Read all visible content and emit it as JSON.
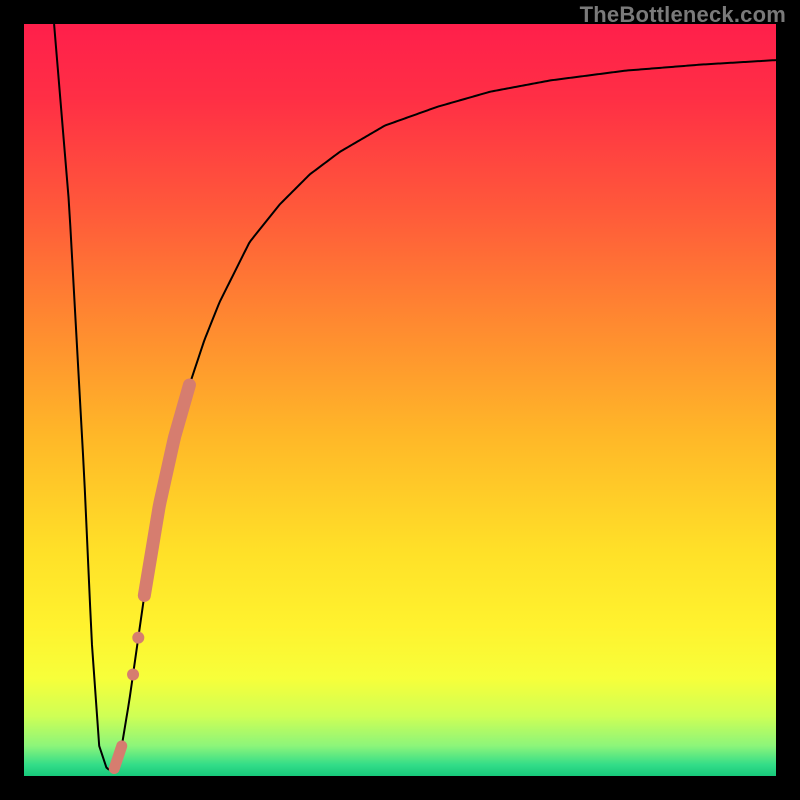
{
  "watermark": "TheBottleneck.com",
  "colors": {
    "background": "#000000",
    "watermark": "#7a7a7a",
    "curve": "#000000",
    "marker": "#d67d6f",
    "gradient_stops": [
      {
        "offset": 0.0,
        "color": "#ff1f4b"
      },
      {
        "offset": 0.1,
        "color": "#ff2f45"
      },
      {
        "offset": 0.25,
        "color": "#ff5a3a"
      },
      {
        "offset": 0.4,
        "color": "#ff8a30"
      },
      {
        "offset": 0.55,
        "color": "#ffb828"
      },
      {
        "offset": 0.7,
        "color": "#ffe028"
      },
      {
        "offset": 0.8,
        "color": "#fff22e"
      },
      {
        "offset": 0.87,
        "color": "#f7ff3a"
      },
      {
        "offset": 0.92,
        "color": "#cfff55"
      },
      {
        "offset": 0.96,
        "color": "#8cf57a"
      },
      {
        "offset": 0.985,
        "color": "#33dd88"
      },
      {
        "offset": 1.0,
        "color": "#17c97b"
      }
    ]
  },
  "chart_data": {
    "type": "line",
    "title": "",
    "xlabel": "",
    "ylabel": "",
    "xlim": [
      0,
      100
    ],
    "ylim": [
      0,
      100
    ],
    "series": [
      {
        "name": "bottleneck-curve",
        "x": [
          4,
          6,
          8,
          9,
          10,
          11,
          11.5,
          12,
          13,
          14,
          16,
          18,
          20,
          22,
          24,
          26,
          28,
          30,
          34,
          38,
          42,
          48,
          55,
          62,
          70,
          80,
          90,
          100
        ],
        "y": [
          100,
          76,
          40,
          18,
          4,
          1,
          0.8,
          1,
          4,
          10,
          24,
          36,
          45,
          52,
          58,
          63,
          67,
          71,
          76,
          80,
          83,
          86.5,
          89,
          91,
          92.5,
          93.8,
          94.6,
          95.2
        ]
      }
    ],
    "markers": [
      {
        "name": "highlight-segment-upper",
        "x_range": [
          16,
          22
        ],
        "approx_y_range": [
          24,
          52
        ]
      },
      {
        "name": "highlight-dot-a",
        "x": 14.5,
        "approx_y": 13
      },
      {
        "name": "highlight-dot-b",
        "x": 15.2,
        "approx_y": 18
      },
      {
        "name": "highlight-segment-lower",
        "x_range": [
          12,
          13
        ],
        "approx_y_range": [
          1,
          4
        ]
      }
    ]
  }
}
